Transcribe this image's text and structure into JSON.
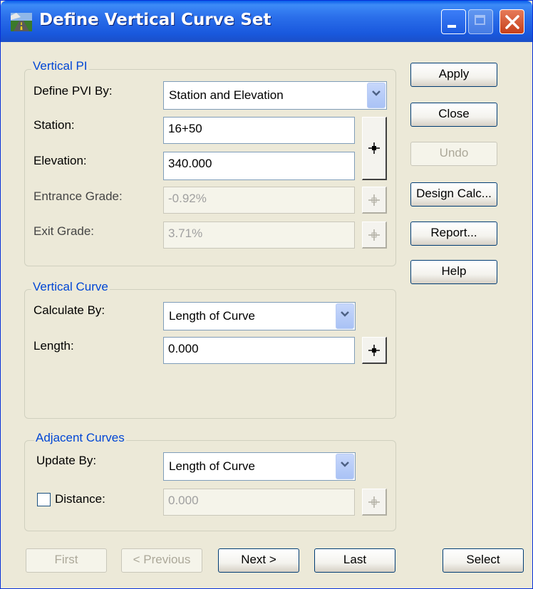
{
  "window": {
    "title": "Define Vertical Curve Set",
    "controls": [
      "minimize-icon",
      "maximize-icon",
      "close-icon"
    ],
    "colors": {
      "titlebar": "#1958DD",
      "face": "#ECE9D8",
      "group_label": "#0046D5"
    }
  },
  "vertical_pi": {
    "group_label": "Vertical PI",
    "define_by_label": "Define PVI By:",
    "define_by_value": "Station and Elevation",
    "station_label": "Station:",
    "station_value": "16+50",
    "elevation_label": "Elevation:",
    "elevation_value": "340.000",
    "entrance_grade_label": "Entrance Grade:",
    "entrance_grade_value": "-0.92%",
    "exit_grade_label": "Exit Grade:",
    "exit_grade_value": "3.71%"
  },
  "vertical_curve": {
    "group_label": "Vertical Curve",
    "calculate_by_label": "Calculate By:",
    "calculate_by_value": "Length of Curve",
    "length_label": "Length:",
    "length_value": "0.000"
  },
  "adjacent_curves": {
    "group_label": "Adjacent Curves",
    "update_by_label": "Update By:",
    "update_by_value": "Length of Curve",
    "distance_label": "Distance:",
    "distance_checked": false,
    "distance_value": "0.000"
  },
  "side_buttons": {
    "apply": "Apply",
    "close": "Close",
    "undo": "Undo",
    "design_calc": "Design Calc...",
    "report": "Report...",
    "help": "Help"
  },
  "nav_buttons": {
    "first": "First",
    "previous": "< Previous",
    "next": "Next >",
    "last": "Last",
    "select": "Select"
  }
}
